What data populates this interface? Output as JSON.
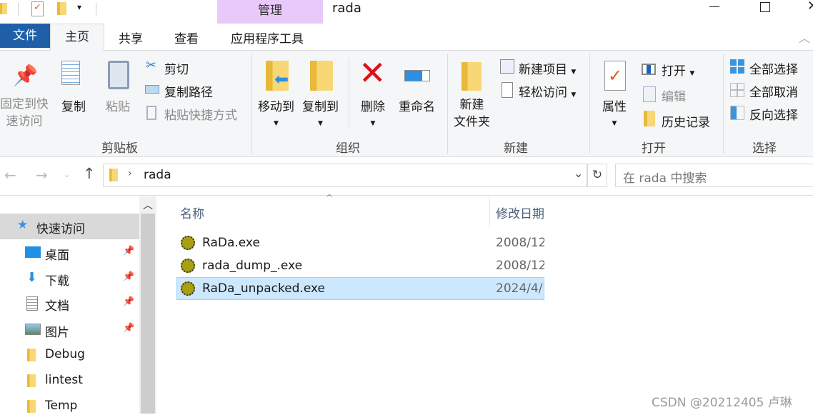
{
  "title": {
    "context_tab": "管理",
    "window_title": "rada"
  },
  "tabs": [
    {
      "label": "文件"
    },
    {
      "label": "主页"
    },
    {
      "label": "共享"
    },
    {
      "label": "查看"
    },
    {
      "label": "应用程序工具"
    }
  ],
  "ribbon": {
    "clipboard": {
      "group": "剪贴板",
      "pin": "固定到快\n速访问",
      "pin1": "固定到快",
      "pin2": "速访问",
      "copy": "复制",
      "paste": "粘贴",
      "cut": "剪切",
      "copy_path": "复制路径",
      "paste_shortcut": "粘贴快捷方式"
    },
    "organize": {
      "group": "组织",
      "move_to": "移动到",
      "copy_to": "复制到",
      "delete": "删除",
      "rename": "重命名"
    },
    "new": {
      "group": "新建",
      "new_folder1": "新建",
      "new_folder2": "文件夹",
      "new_item": "新建项目",
      "easy_access": "轻松访问"
    },
    "open": {
      "group": "打开",
      "properties": "属性",
      "open": "打开",
      "edit": "编辑",
      "history": "历史记录"
    },
    "select": {
      "group": "选择",
      "select_all": "全部选择",
      "select_none": "全部取消",
      "invert": "反向选择"
    }
  },
  "address": {
    "path": "rada",
    "search_placeholder": "在 rada 中搜索"
  },
  "nav": {
    "items": [
      {
        "label": "快速访问"
      },
      {
        "label": "桌面"
      },
      {
        "label": "下载"
      },
      {
        "label": "文档"
      },
      {
        "label": "图片"
      },
      {
        "label": "Debug"
      },
      {
        "label": "lintest"
      },
      {
        "label": "Temp"
      }
    ]
  },
  "files": {
    "columns": [
      "名称",
      "修改日期"
    ],
    "rows": [
      {
        "name": "RaDa.exe",
        "date": "2008/12"
      },
      {
        "name": "rada_dump_.exe",
        "date": "2008/12"
      },
      {
        "name": "RaDa_unpacked.exe",
        "date": "2024/4/"
      }
    ],
    "selected": 2
  },
  "watermark": "CSDN @20212405 卢琳",
  "colors": {
    "file_tab": "#1e5fa8",
    "context_tab": "#e9c8fa",
    "selection": "#cce8ff"
  }
}
